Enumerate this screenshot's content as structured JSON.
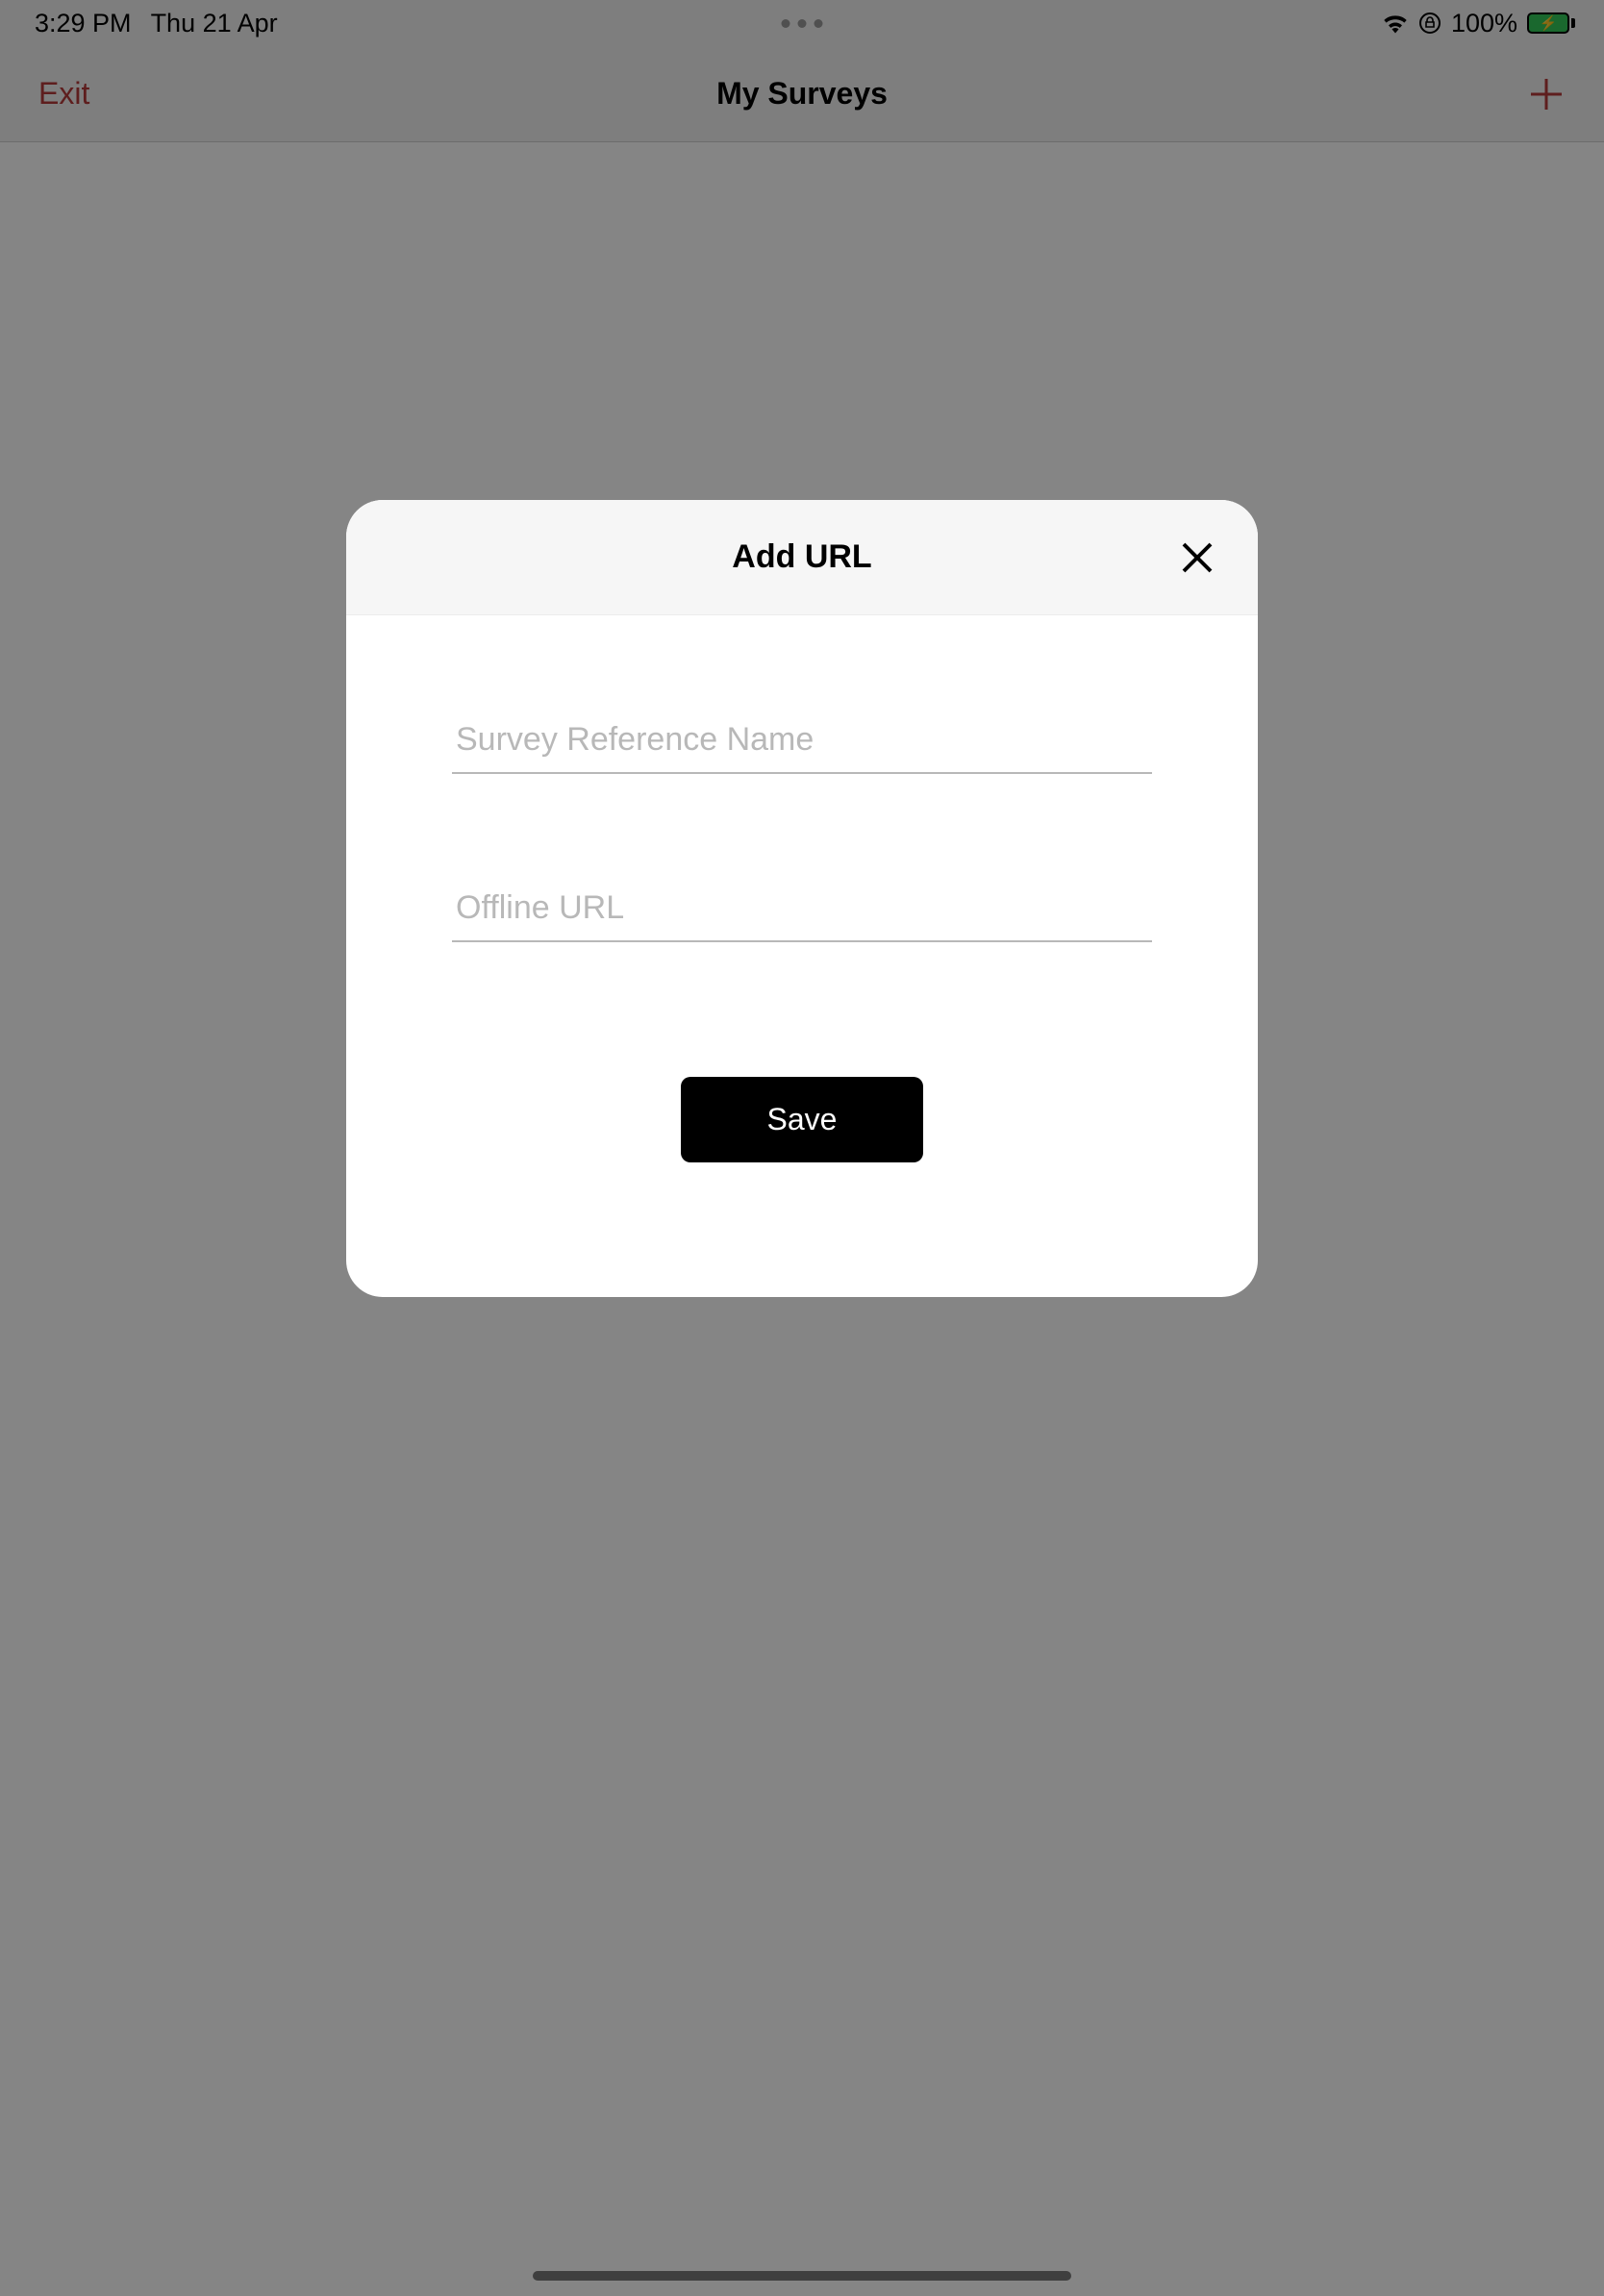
{
  "status": {
    "time": "3:29 PM",
    "date": "Thu 21 Apr",
    "battery_pct": "100%"
  },
  "nav": {
    "exit_label": "Exit",
    "title": "My Surveys"
  },
  "modal": {
    "title": "Add URL",
    "field1_placeholder": "Survey Reference Name",
    "field1_value": "",
    "field2_placeholder": "Offline URL",
    "field2_value": "",
    "save_label": "Save"
  }
}
